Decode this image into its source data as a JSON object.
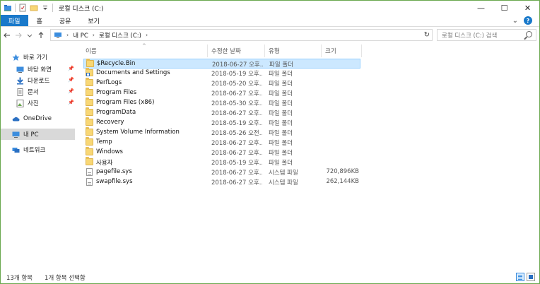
{
  "window": {
    "title": "로컬 디스크 (C:)",
    "controls": {
      "minimize": "—",
      "maximize": "☐",
      "close": "✕"
    }
  },
  "ribbon": {
    "tabs": [
      {
        "label": "파일",
        "active": true
      },
      {
        "label": "홈"
      },
      {
        "label": "공유"
      },
      {
        "label": "보기"
      }
    ],
    "expand": "⌄",
    "help": "?"
  },
  "address": {
    "path": [
      "내 PC",
      "로컬 디스크 (C:)"
    ],
    "refresh": "↻"
  },
  "search": {
    "placeholder": "로컬 디스크 (C:) 검색"
  },
  "nav_pane": {
    "items": [
      {
        "label": "바로 가기",
        "icon": "star-icon"
      },
      {
        "label": "바탕 화면",
        "icon": "desktop-icon",
        "pinned": true
      },
      {
        "label": "다운로드",
        "icon": "download-icon",
        "pinned": true
      },
      {
        "label": "문서",
        "icon": "document-icon",
        "pinned": true
      },
      {
        "label": "사진",
        "icon": "picture-icon",
        "pinned": true
      },
      {
        "label": "OneDrive",
        "icon": "cloud-icon"
      },
      {
        "label": "내 PC",
        "icon": "computer-icon",
        "selected": true
      },
      {
        "label": "네트워크",
        "icon": "network-icon"
      }
    ]
  },
  "file_list": {
    "columns": [
      "이름",
      "수정한 날짜",
      "유형",
      "크기"
    ],
    "rows": [
      {
        "name": "$Recycle.Bin",
        "date": "2018-06-27 오후...",
        "type": "파일 폴더",
        "size": "",
        "icon": "folder-icon",
        "selected": true
      },
      {
        "name": "Documents and Settings",
        "date": "2018-05-19 오후...",
        "type": "파일 폴더",
        "size": "",
        "icon": "folder-shortcut-icon"
      },
      {
        "name": "PerfLogs",
        "date": "2018-05-20 오후...",
        "type": "파일 폴더",
        "size": "",
        "icon": "folder-icon"
      },
      {
        "name": "Program Files",
        "date": "2018-06-27 오후...",
        "type": "파일 폴더",
        "size": "",
        "icon": "folder-icon"
      },
      {
        "name": "Program Files (x86)",
        "date": "2018-05-30 오후...",
        "type": "파일 폴더",
        "size": "",
        "icon": "folder-icon"
      },
      {
        "name": "ProgramData",
        "date": "2018-06-27 오후...",
        "type": "파일 폴더",
        "size": "",
        "icon": "folder-icon"
      },
      {
        "name": "Recovery",
        "date": "2018-05-19 오후...",
        "type": "파일 폴더",
        "size": "",
        "icon": "folder-icon"
      },
      {
        "name": "System Volume Information",
        "date": "2018-05-26 오전...",
        "type": "파일 폴더",
        "size": "",
        "icon": "folder-icon"
      },
      {
        "name": "Temp",
        "date": "2018-06-27 오후...",
        "type": "파일 폴더",
        "size": "",
        "icon": "folder-icon"
      },
      {
        "name": "Windows",
        "date": "2018-06-27 오후...",
        "type": "파일 폴더",
        "size": "",
        "icon": "folder-icon"
      },
      {
        "name": "사용자",
        "date": "2018-05-19 오후...",
        "type": "파일 폴더",
        "size": "",
        "icon": "folder-icon"
      },
      {
        "name": "pagefile.sys",
        "date": "2018-06-27 오후...",
        "type": "시스템 파일",
        "size": "720,896KB",
        "icon": "file-icon"
      },
      {
        "name": "swapfile.sys",
        "date": "2018-06-27 오후...",
        "type": "시스템 파일",
        "size": "262,144KB",
        "icon": "file-icon"
      }
    ]
  },
  "status_bar": {
    "item_count": "13개 항목",
    "selection": "1개 항목 선택함"
  }
}
